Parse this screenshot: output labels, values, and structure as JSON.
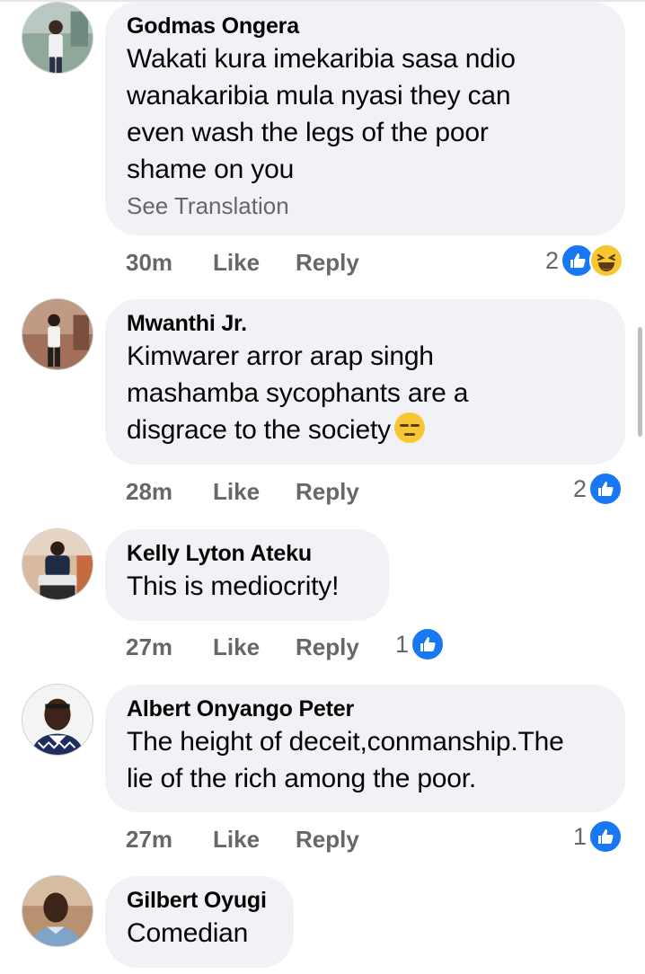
{
  "comments": [
    {
      "author": "Godmas Ongera",
      "lines": [
        "Wakati kura imekaribia sasa ndio",
        "wanakaribia mula nyasi they can",
        "even wash the legs of the poor",
        "shame on you"
      ],
      "see_translation": "See Translation",
      "time": "30m",
      "like": "Like",
      "reply": "Reply",
      "reaction_count": "2",
      "reactions": [
        "like-icon",
        "haha-icon"
      ]
    },
    {
      "author": "Mwanthi Jr.",
      "lines": [
        "Kimwarer arror arap singh",
        "mashamba sycophants are a",
        "disgrace to the society"
      ],
      "emoji": "expressionless-face-emoji",
      "time": "28m",
      "like": "Like",
      "reply": "Reply",
      "reaction_count": "2",
      "reactions": [
        "like-icon"
      ]
    },
    {
      "author": "Kelly Lyton Ateku",
      "lines": [
        "This is mediocrity!"
      ],
      "time": "27m",
      "like": "Like",
      "reply": "Reply",
      "reaction_count": "1",
      "reactions": [
        "like-icon"
      ]
    },
    {
      "author": "Albert Onyango Peter",
      "lines": [
        "The height of deceit,conmanship.The",
        "lie of the rich among the poor."
      ],
      "time": "27m",
      "like": "Like",
      "reply": "Reply",
      "reaction_count": "1",
      "reactions": [
        "like-icon"
      ]
    },
    {
      "author": "Gilbert Oyugi",
      "lines": [
        "Comedian"
      ]
    }
  ],
  "colors": {
    "bubble": "#f0f2f5",
    "meta": "#65676b",
    "like_blue": "#1877f2",
    "text": "#050505"
  }
}
